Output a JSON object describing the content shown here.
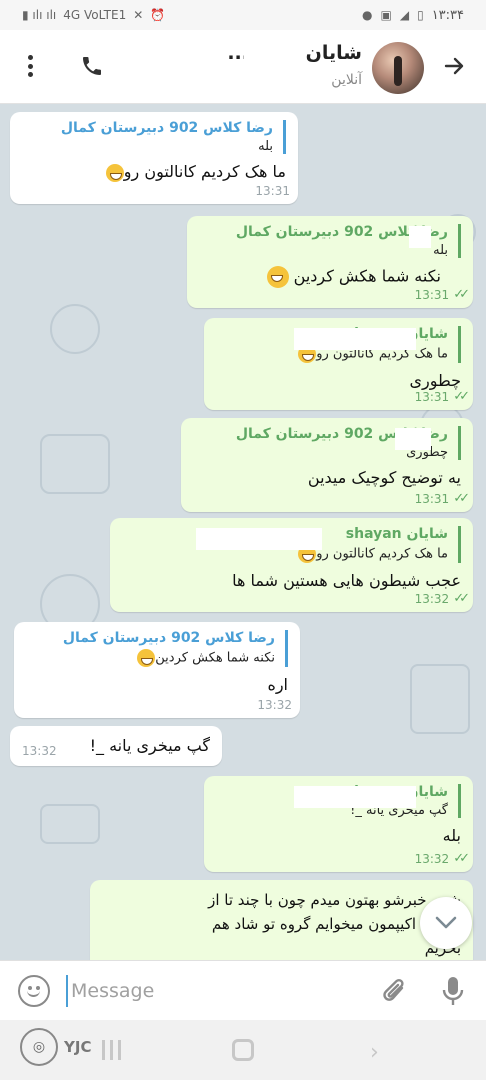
{
  "status_bar": {
    "carrier": "4G VoLTE1",
    "time": "۱۳:۳۴"
  },
  "header": {
    "title": "شایان ' sha...",
    "status": "آنلاین",
    "icons": [
      "more-vert-icon",
      "phone-icon",
      "arrow-right-icon"
    ]
  },
  "messages": [
    {
      "side": "in",
      "reply_name": "رضا کلاس 902 دبیرستان کمال",
      "reply_text": "بله",
      "text": "ما هک کردیم کانالتون رو",
      "time": "13:31"
    },
    {
      "side": "out",
      "reply_name": "رضا کلاس 902 دبیرستان کمال",
      "reply_text": "بله",
      "text": "نکنه شما هکش کردین",
      "time": "13:31"
    },
    {
      "side": "out",
      "reply_name": "شایان shayan",
      "reply_text": "ما هک کردیم کانالتون رو",
      "text": "چطوری",
      "time": "13:31"
    },
    {
      "side": "out",
      "reply_name": "رضا کلاس 902 دبیرستان کمال",
      "reply_text": "چطوری",
      "text": "یه توضیح کوچیک میدین",
      "time": "13:31"
    },
    {
      "side": "out",
      "reply_name": "شایان shayan",
      "reply_text": "ما هک کردیم کانالتون رو",
      "text": "عجب شیطون هایی هستین شما ها",
      "time": "13:32"
    },
    {
      "side": "in",
      "reply_name": "رضا کلاس 902 دبیرستان کمال",
      "reply_text": "نکنه شما هکش کردین",
      "text": "اره",
      "time": "13:32"
    },
    {
      "side": "in",
      "text": "گپ میخری یانه _!",
      "time": "13:32"
    },
    {
      "side": "out",
      "reply_name": "شایان shayan",
      "reply_text": "گپ میخری یانه _!",
      "text": "بله",
      "time": "13:32"
    },
    {
      "side": "in",
      "text_lines": [
        "شنبه خبرشو بهتون میدم چون با چند تا از",
        "های اکیپمون میخوایم گروه تو شاد هم",
        "بخریم"
      ]
    }
  ],
  "composer": {
    "placeholder": "Message",
    "icons": [
      "emoji-icon",
      "attach-icon",
      "mic-icon"
    ]
  },
  "watermark": {
    "text": "YJC"
  },
  "colors": {
    "incoming_bubble": "#ffffff",
    "outgoing_bubble": "#effdde",
    "reply_accent_in": "#4a9fd6",
    "reply_accent_out": "#5fa863",
    "chat_background": "#d4dde2"
  }
}
